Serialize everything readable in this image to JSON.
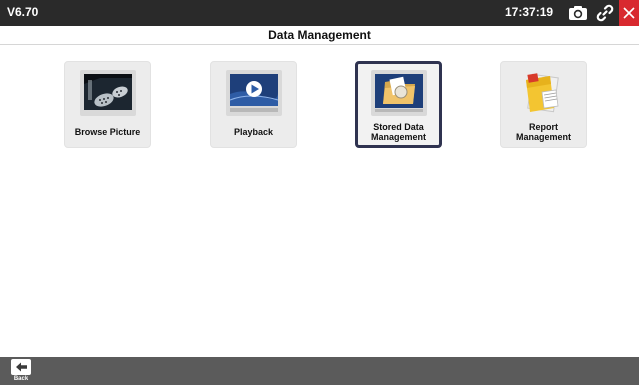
{
  "status_bar": {
    "version": "V6.70",
    "time": "17:37:19",
    "icons": [
      "camera-icon",
      "link-icon",
      "close-icon"
    ],
    "close_color": "#d8292f"
  },
  "header": {
    "title": "Data Management"
  },
  "tiles": [
    {
      "label": "Browse Picture",
      "icon": "browse-picture-icon",
      "selected": false
    },
    {
      "label": "Playback",
      "icon": "playback-icon",
      "selected": false
    },
    {
      "label": "Stored Data Management",
      "label_line1": "Stored Data",
      "label_line2": "Management",
      "icon": "stored-data-icon",
      "selected": true
    },
    {
      "label": "Report Management",
      "label_line1": "Report",
      "label_line2": "Management",
      "icon": "report-icon",
      "selected": false
    }
  ],
  "footer": {
    "back_label": "Back",
    "icon": "back-arrow-icon"
  }
}
